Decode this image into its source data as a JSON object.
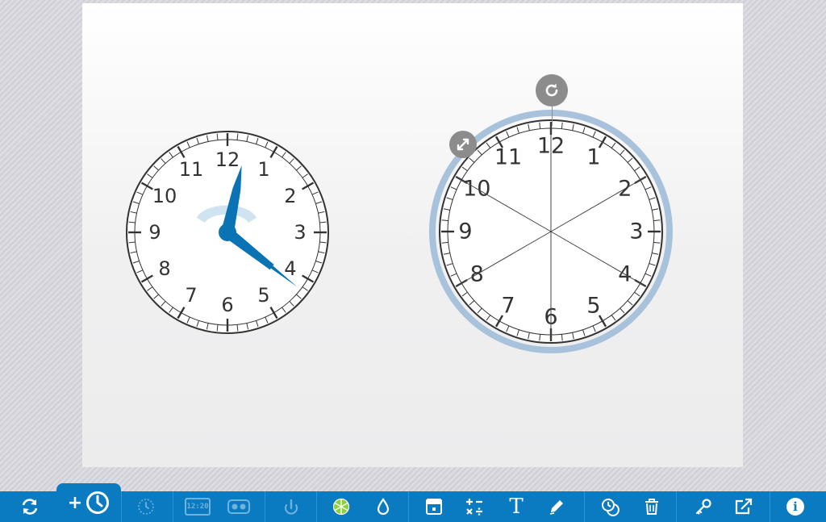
{
  "colors": {
    "accent": "#0a7bc0",
    "hand": "#0a73b3",
    "selection_ring": "#a9c2dc",
    "handle": "#8c8c8c",
    "segment_highlight": "#8bd13b"
  },
  "clock_left": {
    "numbers": [
      "12",
      "1",
      "2",
      "3",
      "4",
      "5",
      "6",
      "7",
      "8",
      "9",
      "10",
      "11"
    ],
    "time": {
      "hour": 12,
      "minute": 23,
      "second": 0
    },
    "hour_hand_angle_deg": 12,
    "minute_hand_angle_deg": 128
  },
  "clock_right": {
    "numbers": [
      "12",
      "1",
      "2",
      "3",
      "4",
      "5",
      "6",
      "7",
      "8",
      "9",
      "10",
      "11"
    ],
    "divisions": 6,
    "selected": true
  },
  "toolbar": {
    "buttons": [
      {
        "name": "reset-icon"
      },
      {
        "name": "add-clock-icon",
        "label": "+"
      },
      {
        "name": "analog-clock-icon"
      },
      {
        "name": "digital-clock-icon",
        "label": "12:20"
      },
      {
        "name": "tape-icon"
      },
      {
        "name": "rotate-hand-icon"
      },
      {
        "name": "fraction-wheel-icon"
      },
      {
        "name": "color-drop-icon"
      },
      {
        "name": "calendar-card-icon"
      },
      {
        "name": "math-operations-icon"
      },
      {
        "name": "text-icon",
        "label": "T"
      },
      {
        "name": "pen-icon"
      },
      {
        "name": "duplicate-clock-icon"
      },
      {
        "name": "trash-icon"
      },
      {
        "name": "settings-key-icon"
      },
      {
        "name": "share-icon"
      },
      {
        "name": "info-icon",
        "label": "i"
      }
    ]
  }
}
